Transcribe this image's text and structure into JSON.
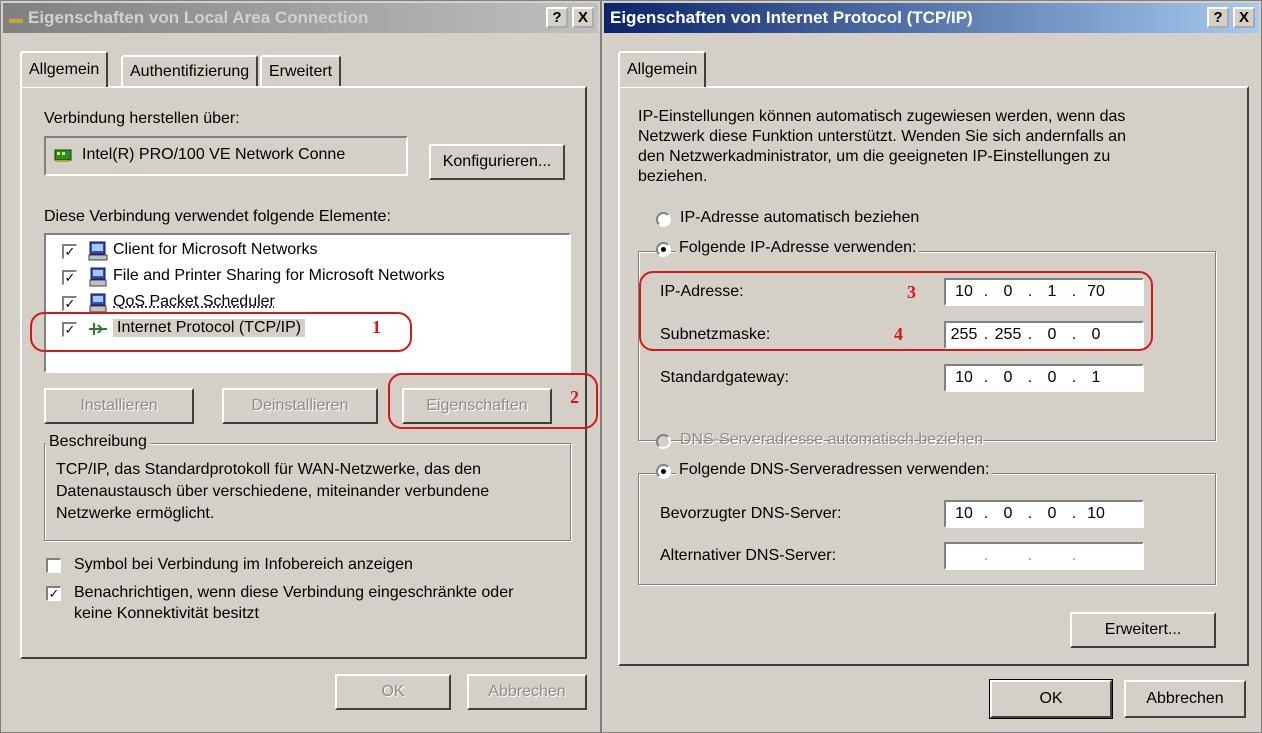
{
  "left_dialog": {
    "title": "Eigenschaften von Local Area Connection",
    "help_btn": "?",
    "close_btn": "X",
    "tabs": [
      "Allgemein",
      "Authentifizierung",
      "Erweitert"
    ],
    "connect_via_label": "Verbindung herstellen über:",
    "adapter_name": "Intel(R) PRO/100 VE Network Conne",
    "configure_btn": "Konfigurieren...",
    "components_label": "Diese Verbindung verwendet folgende Elemente:",
    "components": [
      {
        "label": "Client for Microsoft Networks",
        "checked": true,
        "icon": "network-client-icon"
      },
      {
        "label": "File and Printer Sharing for Microsoft Networks",
        "checked": true,
        "icon": "network-service-icon"
      },
      {
        "label": "QoS Packet Scheduler",
        "checked": true,
        "icon": "network-service-icon"
      },
      {
        "label": "Internet Protocol (TCP/IP)",
        "checked": true,
        "icon": "protocol-icon"
      }
    ],
    "install_btn": "Installieren",
    "uninstall_btn": "Deinstallieren",
    "properties_btn": "Eigenschaften",
    "description_group": "Beschreibung",
    "description_line1": "TCP/IP, das Standardprotokoll für WAN-Netzwerke, das den",
    "description_line2": "Datenaustausch über verschiedene, miteinander verbundene",
    "description_line3": "Netzwerke ermöglicht.",
    "show_icon_label": "Symbol bei Verbindung im Infobereich anzeigen",
    "show_icon_checked": false,
    "notify_line1": "Benachrichtigen, wenn diese Verbindung eingeschränkte oder",
    "notify_line2": "keine Konnektivität besitzt",
    "notify_checked": true,
    "ok_btn": "OK",
    "cancel_btn": "Abbrechen"
  },
  "right_dialog": {
    "title": "Eigenschaften von Internet Protocol (TCP/IP)",
    "help_btn": "?",
    "close_btn": "X",
    "tabs": [
      "Allgemein"
    ],
    "intro_line1": "IP-Einstellungen können automatisch zugewiesen werden, wenn das",
    "intro_line2": "Netzwerk diese Funktion unterstützt. Wenden Sie sich andernfalls an",
    "intro_line3": "den Netzwerkadministrator, um die geeigneten IP-Einstellungen zu",
    "intro_line4": "beziehen.",
    "ip_auto_label": "IP-Adresse automatisch beziehen",
    "ip_manual_label": "Folgende IP-Adresse verwenden:",
    "ip_address_label": "IP-Adresse:",
    "ip_address": [
      "10",
      "0",
      "1",
      "70"
    ],
    "subnet_label": "Subnetzmaske:",
    "subnet_mask": [
      "255",
      "255",
      "0",
      "0"
    ],
    "gateway_label": "Standardgateway:",
    "gateway": [
      "10",
      "0",
      "0",
      "1"
    ],
    "dns_auto_label": "DNS-Serveradresse automatisch beziehen",
    "dns_manual_label": "Folgende DNS-Serveradressen verwenden:",
    "preferred_dns_label": "Bevorzugter DNS-Server:",
    "preferred_dns": [
      "10",
      "0",
      "0",
      "10"
    ],
    "alternate_dns_label": "Alternativer DNS-Server:",
    "alternate_dns": [
      "",
      "",
      "",
      ""
    ],
    "advanced_btn": "Erweitert...",
    "ok_btn": "OK",
    "cancel_btn": "Abbrechen"
  },
  "annotations": {
    "mark1": "1",
    "mark2": "2",
    "mark3": "3",
    "mark4": "4",
    "color": "#d81818"
  }
}
